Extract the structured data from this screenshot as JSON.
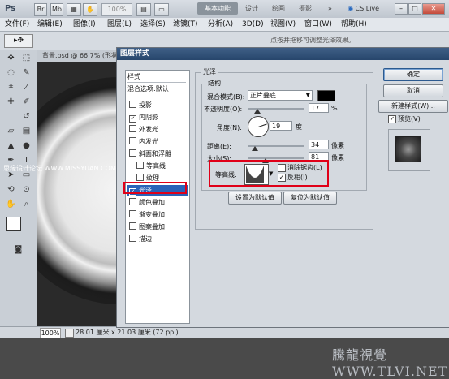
{
  "titlebar": {
    "app_logo": "Ps",
    "zoom_value": "100%",
    "workspace_active": "基本功能",
    "workspace_tabs": [
      "设计",
      "绘画",
      "摄影"
    ],
    "overflow": "»",
    "cs_live": "CS Live",
    "window_controls": [
      "–",
      "□",
      "✕"
    ]
  },
  "menubar": {
    "items": [
      "文件(F)",
      "编辑(E)",
      "图像(I)",
      "图层(L)",
      "选择(S)",
      "滤镜(T)",
      "分析(A)",
      "3D(D)",
      "视图(V)",
      "窗口(W)",
      "帮助(H)"
    ]
  },
  "optionsbar": {
    "hint": "点按并拖移可调整光泽效果。"
  },
  "document": {
    "tab_title": "背景.psd @ 66.7% (形状",
    "zoom": "100%",
    "doc_size": "28.01 厘米 x 21.03 厘米 (72 ppi)"
  },
  "dialog": {
    "title": "图层样式",
    "styles_header": "样式",
    "blend_options": "混合选项:默认",
    "style_items": [
      {
        "label": "投影",
        "checked": false
      },
      {
        "label": "内阴影",
        "checked": true
      },
      {
        "label": "外发光",
        "checked": false
      },
      {
        "label": "内发光",
        "checked": false
      },
      {
        "label": "斜面和浮雕",
        "checked": false
      },
      {
        "label": "等高线",
        "checked": false
      },
      {
        "label": "纹理",
        "checked": false
      },
      {
        "label": "光泽",
        "checked": true
      },
      {
        "label": "颜色叠加",
        "checked": false
      },
      {
        "label": "渐变叠加",
        "checked": false
      },
      {
        "label": "图案叠加",
        "checked": false
      },
      {
        "label": "描边",
        "checked": false
      }
    ],
    "panel_title": "光泽",
    "structure_title": "结构",
    "blend_mode_label": "混合模式(B):",
    "blend_mode_value": "正片叠底",
    "blend_color": "#000000",
    "opacity_label": "不透明度(O):",
    "opacity_value": "17",
    "opacity_fraction": 0.17,
    "percent": "%",
    "angle_label": "角度(N):",
    "angle_value": "19",
    "angle_unit": "度",
    "distance_label": "距离(E):",
    "distance_value": "34",
    "distance_fraction": 0.13,
    "size_label": "大小(S):",
    "size_value": "81",
    "size_fraction": 0.32,
    "pixel_unit": "像素",
    "contour_label": "等高线:",
    "anti_alias_label": "消除锯齿(L)",
    "anti_alias_checked": false,
    "invert_label": "反相(I)",
    "invert_checked": true,
    "default_button": "设置为默认值",
    "reset_button": "复位为默认值",
    "ok_button": "确定",
    "cancel_button": "取消",
    "new_style_button": "新建样式(W)...",
    "preview_label": "预览(V)",
    "preview_checked": true
  },
  "watermark": "騰龍視覺 WWW.TLVI.NET",
  "site_mark": "思缘设计论坛 WWW.MISSYUAN.COM"
}
